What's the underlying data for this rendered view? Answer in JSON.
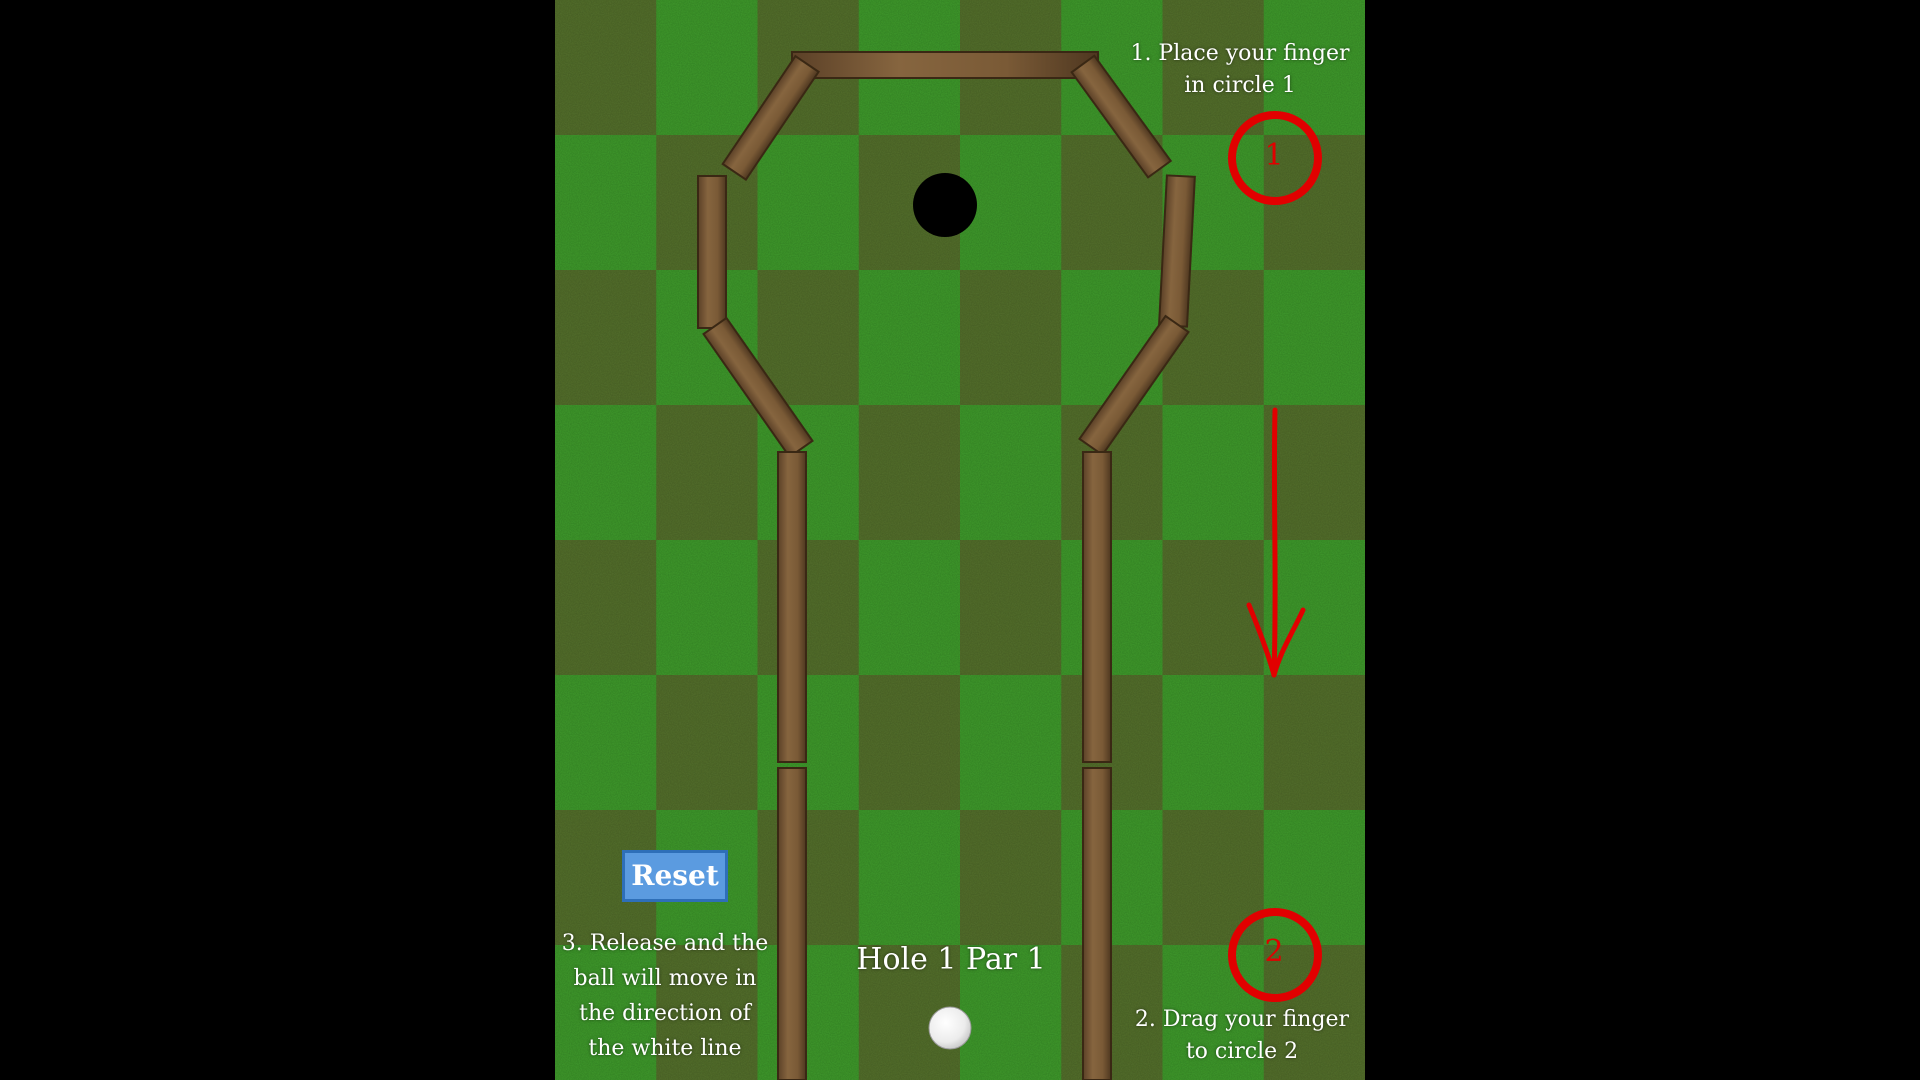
{
  "game": {
    "hole_label": "Hole 1 Par 1",
    "reset_label": "Reset",
    "instructions": {
      "step1": "1. Place your finger\nin circle 1",
      "step2": "2. Drag your finger\nto circle 2",
      "step3": "3. Release and the\nball will move in\nthe direction of\nthe white line"
    },
    "circles": {
      "circle1": "1",
      "circle2": "2"
    }
  },
  "colors": {
    "background": "#000000",
    "grass_light": "#3f9a2e",
    "grass_dark": "#55702d",
    "wood": "#7a5a36",
    "annotation_red": "#e10000",
    "button_fill": "#5b9be0",
    "button_border": "#2e6fb8",
    "ball": "#f4f4f4",
    "cup": "#000000"
  }
}
